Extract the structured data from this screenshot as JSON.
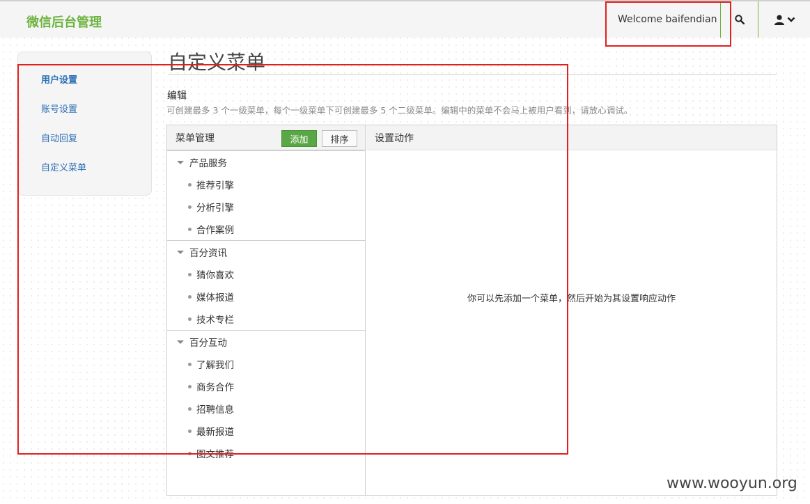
{
  "header": {
    "brand": "微信后台管理",
    "welcome": "Welcome baifendian",
    "search_icon": "search-icon",
    "user_icon": "user-icon"
  },
  "sidebar": {
    "items": [
      {
        "label": "用户设置"
      },
      {
        "label": "账号设置"
      },
      {
        "label": "自动回复"
      },
      {
        "label": "自定义菜单"
      }
    ]
  },
  "main": {
    "title": "自定义菜单",
    "edit_label": "编辑",
    "edit_desc": "可创建最多 3 个一级菜单，每个一级菜单下可创建最多 5 个二级菜单。编辑中的菜单不会马上被用户看到，请放心调试。"
  },
  "menu_panel": {
    "header": "菜单管理",
    "add_label": "添加",
    "sort_label": "排序",
    "groups": [
      {
        "label": "产品服务",
        "items": [
          "推荐引擎",
          "分析引擎",
          "合作案例"
        ]
      },
      {
        "label": "百分资讯",
        "items": [
          "猜你喜欢",
          "媒体报道",
          "技术专栏"
        ]
      },
      {
        "label": "百分互动",
        "items": [
          "了解我们",
          "商务合作",
          "招聘信息",
          "最新报道",
          "图文推荐"
        ]
      }
    ]
  },
  "action_panel": {
    "header": "设置动作",
    "hint": "你可以先添加一个菜单，然后开始为其设置响应动作"
  },
  "watermark": "www.wooyun.org",
  "colors": {
    "brand": "#6cb33e",
    "add_button": "#5aa845",
    "link": "#2a6db5",
    "annotation": "#e0201e"
  }
}
